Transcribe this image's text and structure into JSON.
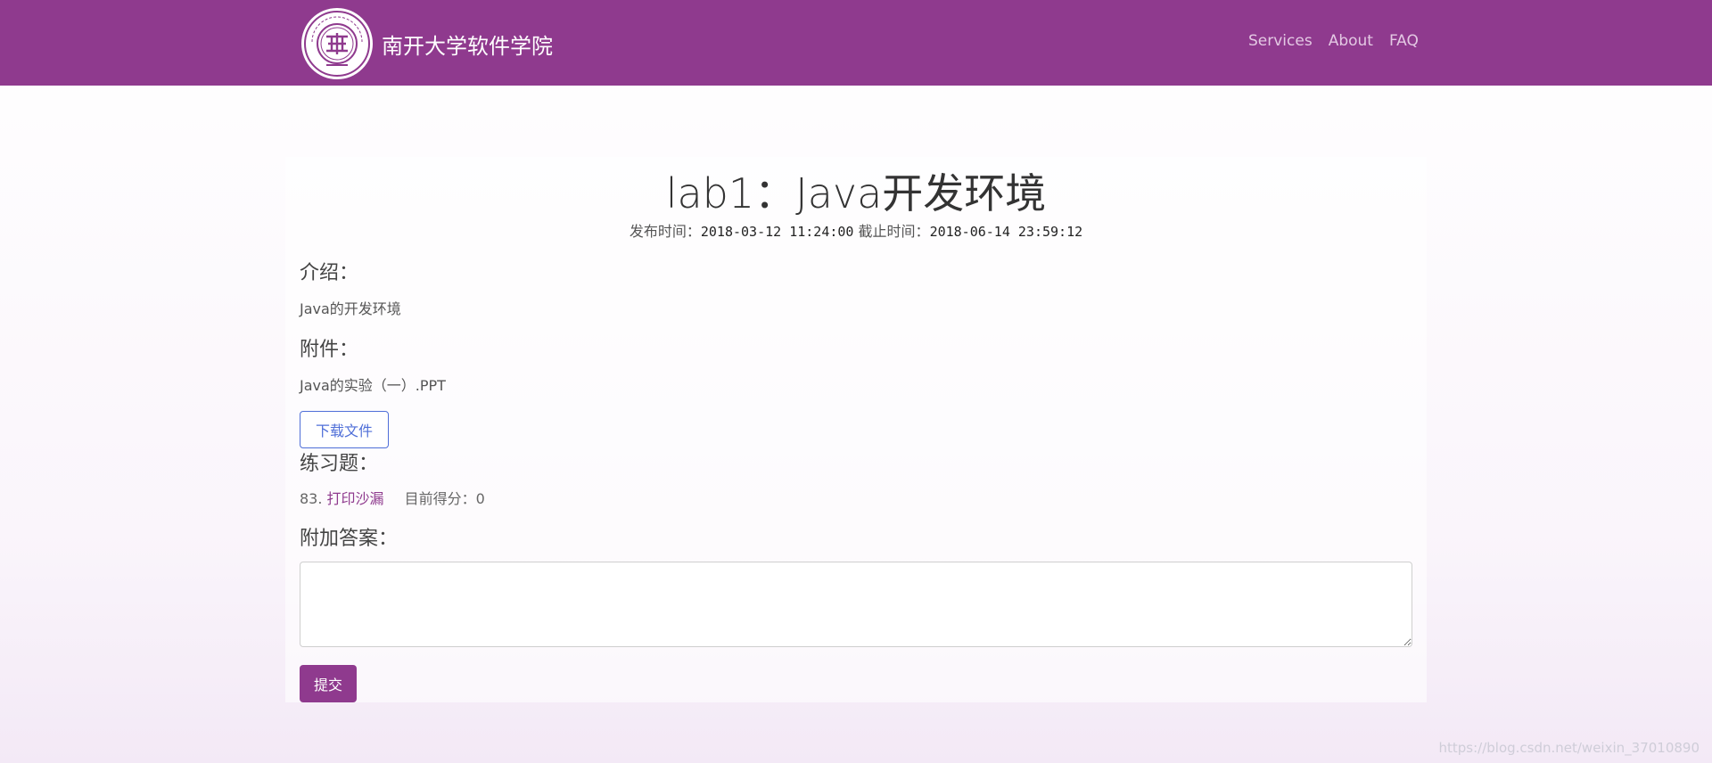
{
  "navbar": {
    "brand_name": "南开大学软件学院",
    "logo_icon": "nankai-university-seal-icon",
    "logo_text": "NANKAI UNIVERSITY 1919",
    "links": [
      {
        "label": "Services"
      },
      {
        "label": "About"
      },
      {
        "label": "FAQ"
      }
    ]
  },
  "lab": {
    "title": "lab1：Java开发环境",
    "publish_label": "发布时间：",
    "publish_time": "2018-03-12 11:24:00",
    "deadline_label": "截止时间：",
    "deadline_time": "2018-06-14 23:59:12",
    "intro_heading": "介绍：",
    "intro_text": "Java的开发环境",
    "attachment_heading": "附件：",
    "attachment_name": "Java的实验（一）.PPT",
    "download_label": "下载文件",
    "exercise_heading": "练习题：",
    "exercise_number": "83.",
    "exercise_title": "打印沙漏",
    "score_label": "目前得分：",
    "score_value": "0",
    "answer_heading": "附加答案：",
    "answer_value": "",
    "submit_label": "提交"
  },
  "watermark": "https://blog.csdn.net/weixin_37010890",
  "colors": {
    "brand": "#8f3a8e",
    "link_blue": "#4f6fd8"
  }
}
